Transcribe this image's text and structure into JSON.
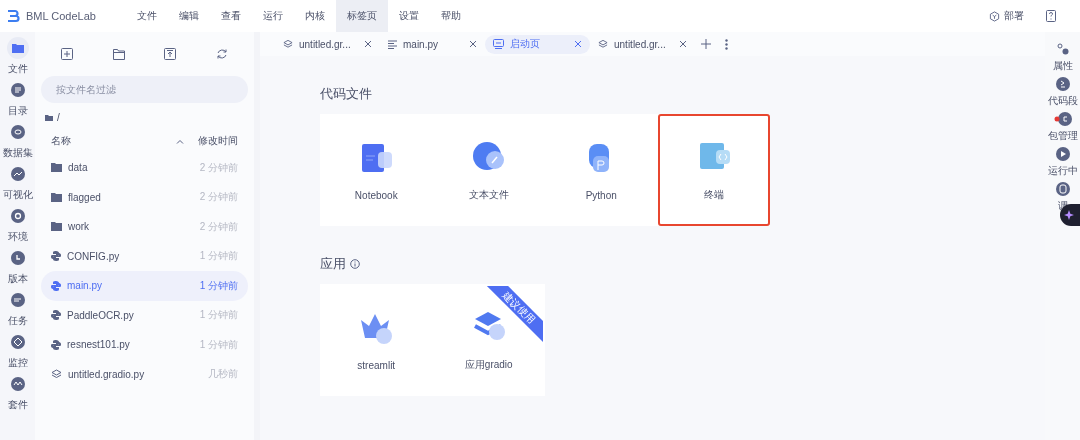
{
  "app": {
    "title": "BML CodeLab"
  },
  "menu": [
    {
      "label": "文件",
      "selected": false
    },
    {
      "label": "编辑",
      "selected": false
    },
    {
      "label": "查看",
      "selected": false
    },
    {
      "label": "运行",
      "selected": false
    },
    {
      "label": "内核",
      "selected": false
    },
    {
      "label": "标签页",
      "selected": true
    },
    {
      "label": "设置",
      "selected": false
    },
    {
      "label": "帮助",
      "selected": false
    }
  ],
  "header_actions": {
    "deploy": "部署"
  },
  "left_rail": [
    {
      "label": "文件",
      "kind": "folder",
      "selected": true
    },
    {
      "label": "目录",
      "kind": "list",
      "selected": false
    },
    {
      "label": "数据集",
      "kind": "dataset",
      "selected": false
    },
    {
      "label": "可视化",
      "kind": "chart",
      "selected": false
    },
    {
      "label": "环境",
      "kind": "ring",
      "selected": false
    },
    {
      "label": "版本",
      "kind": "clock",
      "selected": false
    },
    {
      "label": "任务",
      "kind": "task",
      "selected": false
    },
    {
      "label": "监控",
      "kind": "monitor",
      "selected": false
    },
    {
      "label": "套件",
      "kind": "suite",
      "selected": false
    }
  ],
  "file_panel": {
    "filter": {
      "placeholder": "按文件名过滤"
    },
    "path": "/",
    "columns": [
      "名称",
      "修改时间"
    ],
    "rows": [
      {
        "name": "data",
        "time": "2 分钟前",
        "kind": "folder",
        "selected": false
      },
      {
        "name": "flagged",
        "time": "2 分钟前",
        "kind": "folder",
        "selected": false
      },
      {
        "name": "work",
        "time": "2 分钟前",
        "kind": "folder",
        "selected": false
      },
      {
        "name": "CONFIG.py",
        "time": "1 分钟前",
        "kind": "python",
        "selected": false
      },
      {
        "name": "main.py",
        "time": "1 分钟前",
        "kind": "python",
        "selected": true
      },
      {
        "name": "PaddleOCR.py",
        "time": "1 分钟前",
        "kind": "python",
        "selected": false
      },
      {
        "name": "resnest101.py",
        "time": "1 分钟前",
        "kind": "python",
        "selected": false
      },
      {
        "name": "untitled.gradio.py",
        "time": "几秒前",
        "kind": "gradio",
        "selected": false
      }
    ]
  },
  "tabs": [
    {
      "label": "untitled.gr...",
      "kind": "gradio",
      "selected": false
    },
    {
      "label": "main.py",
      "kind": "text",
      "selected": false
    },
    {
      "label": "启动页",
      "kind": "launcher",
      "selected": true
    },
    {
      "label": "untitled.gr...",
      "kind": "gradio",
      "selected": false
    }
  ],
  "sections": [
    {
      "title": "代码文件",
      "info": false,
      "cards": [
        {
          "label": "Notebook",
          "kind": "notebook",
          "highlighted": false
        },
        {
          "label": "文本文件",
          "kind": "textfile",
          "highlighted": false
        },
        {
          "label": "Python",
          "kind": "python",
          "highlighted": false
        },
        {
          "label": "终端",
          "kind": "terminal",
          "highlighted": true
        }
      ]
    },
    {
      "title": "应用",
      "info": true,
      "cards": [
        {
          "label": "streamlit",
          "kind": "streamlit",
          "highlighted": false
        },
        {
          "label": "应用gradio",
          "kind": "gradio",
          "highlighted": false,
          "badge": "建议使用"
        }
      ]
    }
  ],
  "right_rail": [
    {
      "label": "属性",
      "kind": "gears",
      "dot": false
    },
    {
      "label": "代码段",
      "kind": "snippet",
      "dot": false
    },
    {
      "label": "包管理",
      "kind": "package",
      "dot": true
    },
    {
      "label": "运行中",
      "kind": "play",
      "dot": false
    },
    {
      "label": "调",
      "kind": "debug",
      "dot": false
    }
  ]
}
